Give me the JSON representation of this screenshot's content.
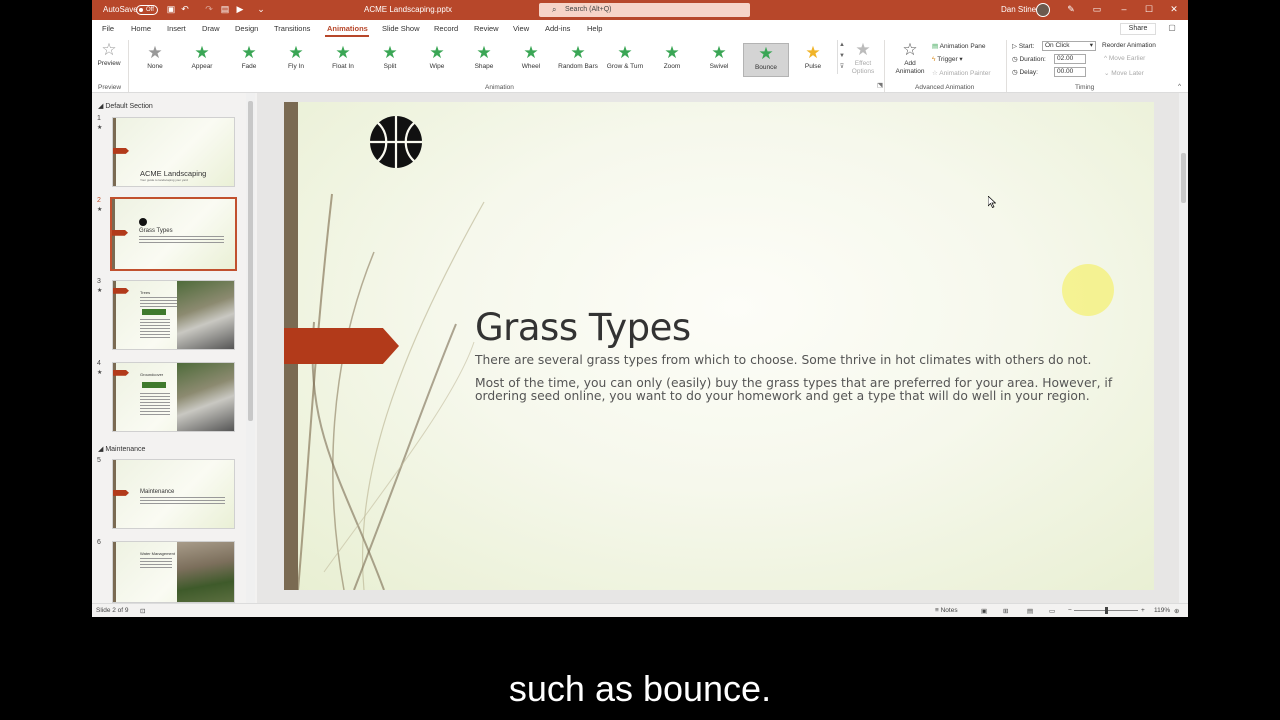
{
  "titlebar": {
    "autosave_label": "AutoSave",
    "autosave_state": "Off",
    "document_title": "ACME Landscaping.pptx",
    "search_placeholder": "Search (Alt+Q)",
    "user_name": "Dan Stine",
    "accent_color": "#b7472a"
  },
  "tabs": [
    {
      "label": "File"
    },
    {
      "label": "Home"
    },
    {
      "label": "Insert"
    },
    {
      "label": "Draw"
    },
    {
      "label": "Design"
    },
    {
      "label": "Transitions"
    },
    {
      "label": "Animations",
      "active": true
    },
    {
      "label": "Slide Show"
    },
    {
      "label": "Record"
    },
    {
      "label": "Review"
    },
    {
      "label": "View"
    },
    {
      "label": "Add-ins"
    },
    {
      "label": "Help"
    }
  ],
  "share_label": "Share",
  "ribbon": {
    "preview": {
      "button": "Preview",
      "group": "Preview"
    },
    "animation_group_label": "Animation",
    "animations": [
      {
        "label": "None",
        "icon": "star-none-icon"
      },
      {
        "label": "Appear",
        "icon": "star-appear-icon"
      },
      {
        "label": "Fade",
        "icon": "star-fade-icon"
      },
      {
        "label": "Fly In",
        "icon": "star-fly-in-icon"
      },
      {
        "label": "Float In",
        "icon": "star-float-in-icon"
      },
      {
        "label": "Split",
        "icon": "star-split-icon"
      },
      {
        "label": "Wipe",
        "icon": "star-wipe-icon"
      },
      {
        "label": "Shape",
        "icon": "star-shape-icon"
      },
      {
        "label": "Wheel",
        "icon": "star-wheel-icon"
      },
      {
        "label": "Random Bars",
        "icon": "star-random-bars-icon"
      },
      {
        "label": "Grow & Turn",
        "icon": "star-grow-turn-icon"
      },
      {
        "label": "Zoom",
        "icon": "star-zoom-icon"
      },
      {
        "label": "Swivel",
        "icon": "star-swivel-icon"
      },
      {
        "label": "Bounce",
        "icon": "star-bounce-icon",
        "selected": true
      },
      {
        "label": "Pulse",
        "icon": "star-pulse-icon"
      }
    ],
    "effect_options_line1": "Effect",
    "effect_options_line2": "Options",
    "advanced": {
      "group": "Advanced Animation",
      "add_line1": "Add",
      "add_line2": "Animation",
      "pane": "Animation Pane",
      "trigger": "Trigger",
      "painter": "Animation Painter"
    },
    "timing": {
      "group": "Timing",
      "start_label": "Start:",
      "start_value": "On Click",
      "duration_label": "Duration:",
      "duration_value": "02.00",
      "delay_label": "Delay:",
      "delay_value": "00.00",
      "reorder": "Reorder Animation",
      "move_earlier": "Move Earlier",
      "move_later": "Move Later"
    }
  },
  "thumbnails": {
    "section_default": "Default Section",
    "section_maintenance": "Maintenance",
    "slides": [
      {
        "num": "1",
        "title": "ACME Landscaping",
        "sub": "Your guide to landscaping your yard"
      },
      {
        "num": "2",
        "title": "Grass Types"
      },
      {
        "num": "3",
        "title": "Trees"
      },
      {
        "num": "4",
        "title": "Groundcover"
      },
      {
        "num": "5",
        "title": "Maintenance"
      },
      {
        "num": "6",
        "title": "Water Management"
      }
    ]
  },
  "slide": {
    "title": "Grass Types",
    "para1": "There are several grass types from which to choose. Some thrive in hot climates with others do not.",
    "para2": "Most of the time, you can only (easily) buy the grass types that are preferred for your area. However, if ordering seed online, you want to do your homework and get a type that will do well in your region."
  },
  "statusbar": {
    "slide_counter": "Slide 2 of 9",
    "notes": "Notes",
    "zoom": "119%"
  },
  "caption": "such as bounce."
}
